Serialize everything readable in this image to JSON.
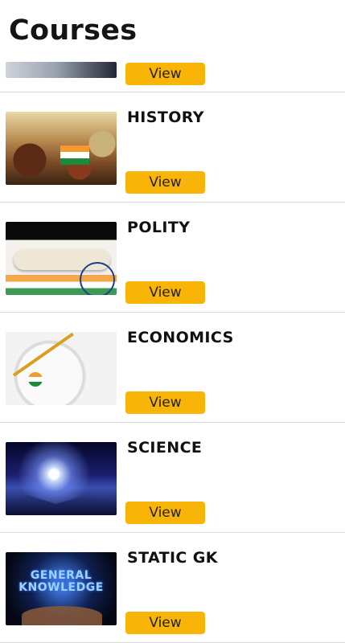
{
  "page": {
    "title": "Courses"
  },
  "courses": [
    {
      "name": "",
      "view_label": "View",
      "thumb": "space-earth-image"
    },
    {
      "name": "HISTORY",
      "view_label": "View",
      "thumb": "history-collage-image"
    },
    {
      "name": "POLITY",
      "view_label": "View",
      "thumb": "constitution-scroll-image"
    },
    {
      "name": "ECONOMICS",
      "view_label": "View",
      "thumb": "economy-compass-image"
    },
    {
      "name": "SCIENCE",
      "view_label": "View",
      "thumb": "space-landscape-image"
    },
    {
      "name": "STATIC GK",
      "view_label": "View",
      "thumb": "general-knowledge-image",
      "thumb_text": "GENERAL KNOWLEDGE"
    }
  ],
  "colors": {
    "accent": "#f9b408",
    "divider": "#d9d9d9",
    "text": "#111111"
  }
}
